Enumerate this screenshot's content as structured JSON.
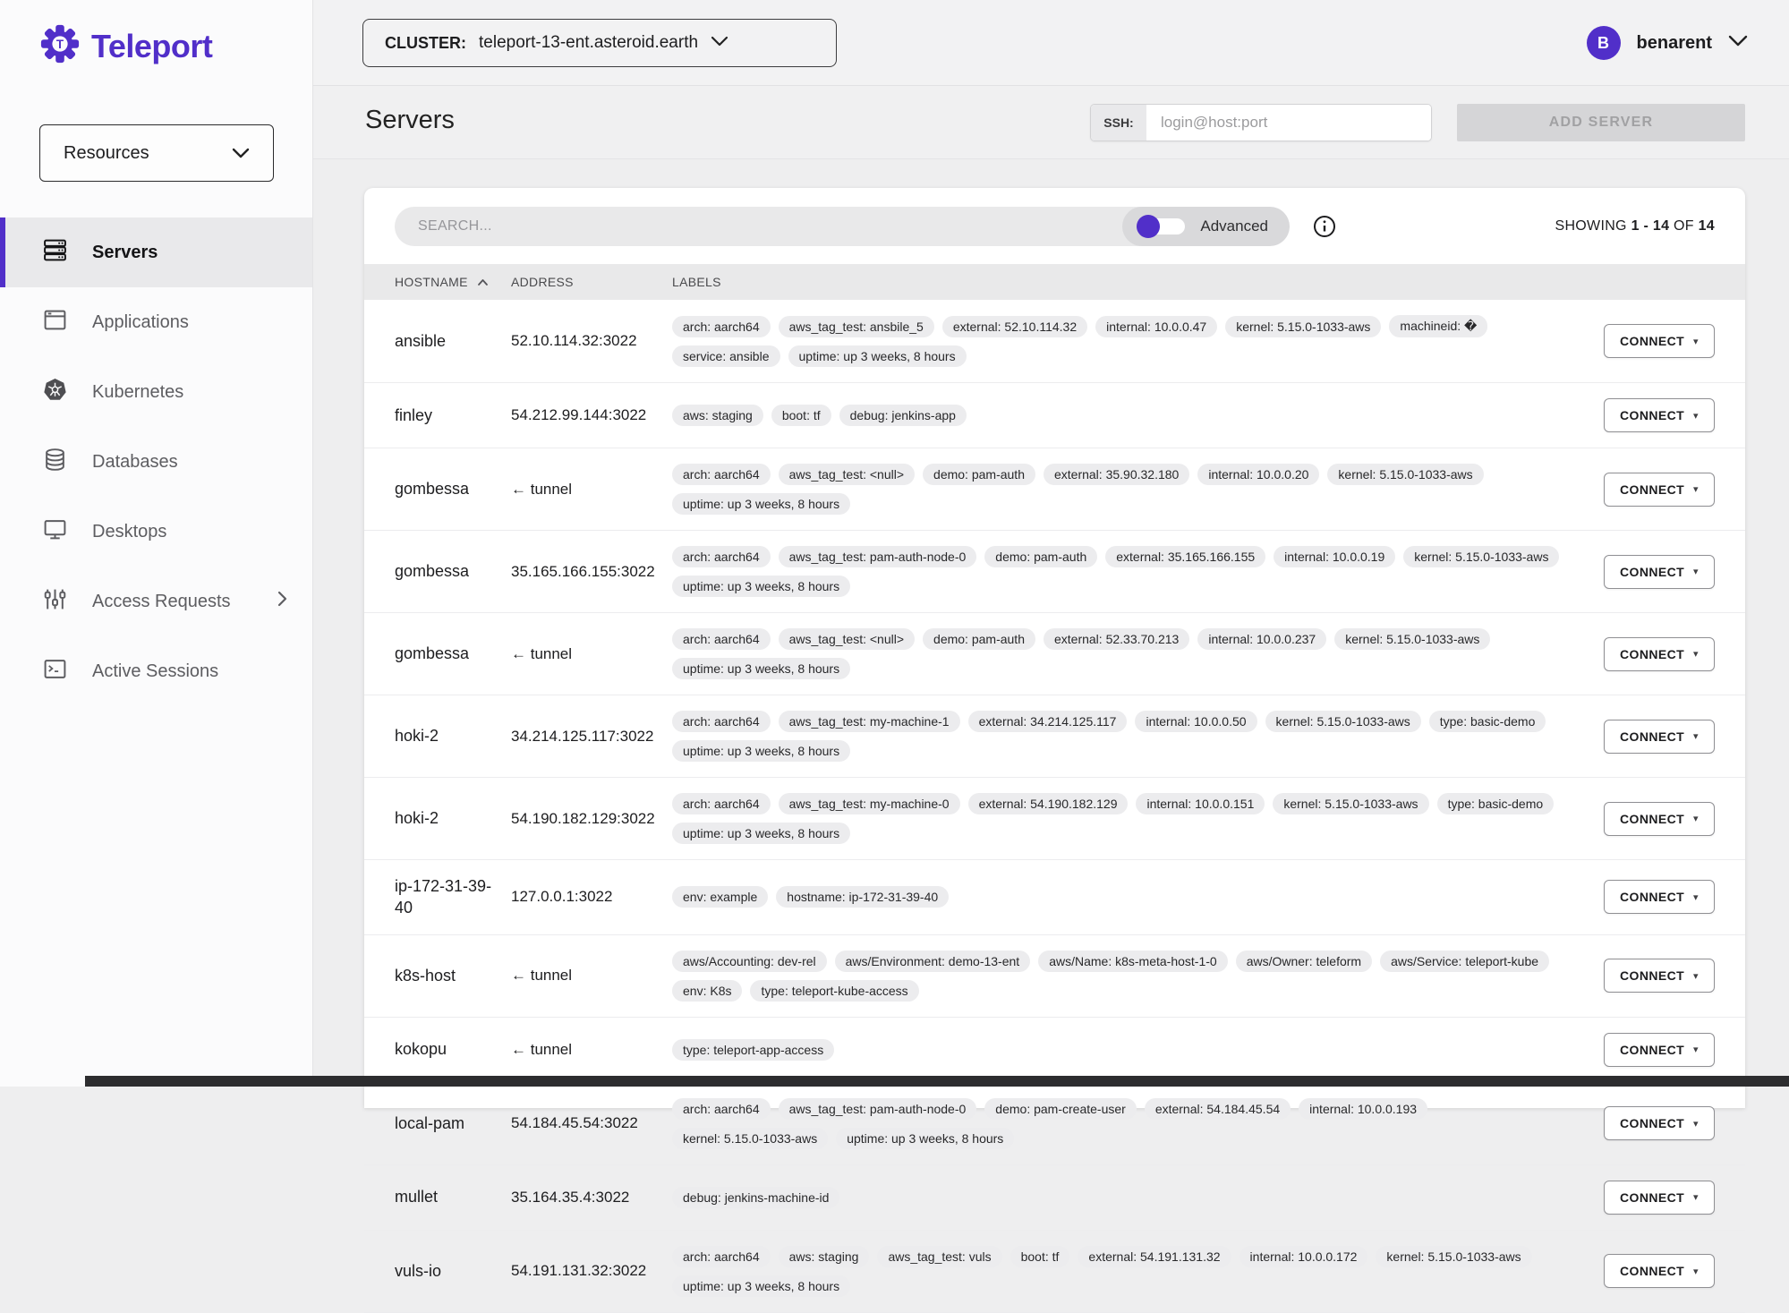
{
  "colors": {
    "accent": "#512fc9"
  },
  "brand": {
    "name": "Teleport"
  },
  "sidebar": {
    "resources_label": "Resources",
    "items": [
      {
        "label": "Servers",
        "active": true
      },
      {
        "label": "Applications",
        "active": false
      },
      {
        "label": "Kubernetes",
        "active": false
      },
      {
        "label": "Databases",
        "active": false
      },
      {
        "label": "Desktops",
        "active": false
      },
      {
        "label": "Access Requests",
        "active": false
      },
      {
        "label": "Active Sessions",
        "active": false
      }
    ]
  },
  "topbar": {
    "cluster_label": "CLUSTER:",
    "cluster_value": "teleport-13-ent.asteroid.earth",
    "user": {
      "initial": "B",
      "name": "benarent"
    }
  },
  "page": {
    "title": "Servers",
    "ssh_label": "SSH:",
    "ssh_placeholder": "login@host:port",
    "add_server_label": "ADD SERVER"
  },
  "toolbar": {
    "search_placeholder": "SEARCH...",
    "advanced_label": "Advanced",
    "showing_prefix": "SHOWING ",
    "showing_range": "1 - 14",
    "showing_of": " OF ",
    "showing_total": "14"
  },
  "table": {
    "columns": [
      "HOSTNAME",
      "ADDRESS",
      "LABELS"
    ],
    "connect_label": "CONNECT",
    "rows": [
      {
        "hostname": "ansible",
        "address": "52.10.114.32:3022",
        "labels": [
          "arch: aarch64",
          "aws_tag_test: ansbile_5",
          "external: 52.10.114.32",
          "internal: 10.0.0.47",
          "kernel: 5.15.0-1033-aws",
          "machineid: �",
          "service: ansible",
          "uptime: up 3 weeks, 8 hours"
        ]
      },
      {
        "hostname": "finley",
        "address": "54.212.99.144:3022",
        "labels": [
          "aws: staging",
          "boot: tf",
          "debug: jenkins-app"
        ]
      },
      {
        "hostname": "gombessa",
        "address": "← tunnel",
        "labels": [
          "arch: aarch64",
          "aws_tag_test: <null>",
          "demo: pam-auth",
          "external: 35.90.32.180",
          "internal: 10.0.0.20",
          "kernel: 5.15.0-1033-aws",
          "uptime: up 3 weeks, 8 hours"
        ]
      },
      {
        "hostname": "gombessa",
        "address": "35.165.166.155:3022",
        "labels": [
          "arch: aarch64",
          "aws_tag_test: pam-auth-node-0",
          "demo: pam-auth",
          "external: 35.165.166.155",
          "internal: 10.0.0.19",
          "kernel: 5.15.0-1033-aws",
          "uptime: up 3 weeks, 8 hours"
        ]
      },
      {
        "hostname": "gombessa",
        "address": "← tunnel",
        "labels": [
          "arch: aarch64",
          "aws_tag_test: <null>",
          "demo: pam-auth",
          "external: 52.33.70.213",
          "internal: 10.0.0.237",
          "kernel: 5.15.0-1033-aws",
          "uptime: up 3 weeks, 8 hours"
        ]
      },
      {
        "hostname": "hoki-2",
        "address": "34.214.125.117:3022",
        "labels": [
          "arch: aarch64",
          "aws_tag_test: my-machine-1",
          "external: 34.214.125.117",
          "internal: 10.0.0.50",
          "kernel: 5.15.0-1033-aws",
          "type: basic-demo",
          "uptime: up 3 weeks, 8 hours"
        ]
      },
      {
        "hostname": "hoki-2",
        "address": "54.190.182.129:3022",
        "labels": [
          "arch: aarch64",
          "aws_tag_test: my-machine-0",
          "external: 54.190.182.129",
          "internal: 10.0.0.151",
          "kernel: 5.15.0-1033-aws",
          "type: basic-demo",
          "uptime: up 3 weeks, 8 hours"
        ]
      },
      {
        "hostname": "ip-172-31-39-40",
        "address": "127.0.0.1:3022",
        "labels": [
          "env: example",
          "hostname: ip-172-31-39-40"
        ]
      },
      {
        "hostname": "k8s-host",
        "address": "← tunnel",
        "labels": [
          "aws/Accounting: dev-rel",
          "aws/Environment: demo-13-ent",
          "aws/Name: k8s-meta-host-1-0",
          "aws/Owner: teleform",
          "aws/Service: teleport-kube",
          "env: K8s",
          "type: teleport-kube-access"
        ]
      },
      {
        "hostname": "kokopu",
        "address": "← tunnel",
        "labels": [
          "type: teleport-app-access"
        ]
      },
      {
        "hostname": "local-pam",
        "address": "54.184.45.54:3022",
        "labels": [
          "arch: aarch64",
          "aws_tag_test: pam-auth-node-0",
          "demo: pam-create-user",
          "external: 54.184.45.54",
          "internal: 10.0.0.193",
          "kernel: 5.15.0-1033-aws",
          "uptime: up 3 weeks, 8 hours"
        ]
      },
      {
        "hostname": "mullet",
        "address": "35.164.35.4:3022",
        "labels": [
          "debug: jenkins-machine-id"
        ]
      },
      {
        "hostname": "vuls-io",
        "address": "54.191.131.32:3022",
        "labels": [
          "arch: aarch64",
          "aws: staging",
          "aws_tag_test: vuls",
          "boot: tf",
          "external: 54.191.131.32",
          "internal: 10.0.0.172",
          "kernel: 5.15.0-1033-aws",
          "uptime: up 3 weeks, 8 hours"
        ]
      }
    ]
  }
}
